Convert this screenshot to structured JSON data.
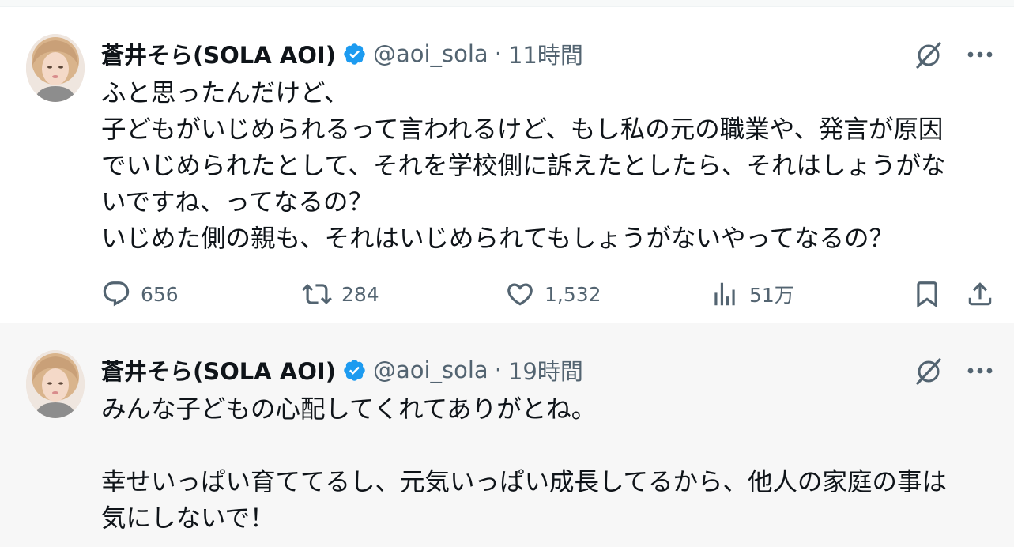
{
  "tweets": [
    {
      "author_name": "蒼井そら(SOLA AOI)",
      "handle": "@aoi_sola",
      "separator": "·",
      "time": "11時間",
      "lines": [
        "ふと思ったんだけど、",
        "子どもがいじめられるって言われるけど、もし私の元の職業や、発言が原因",
        "でいじめられたとして、それを学校側に訴えたとしたら、それはしょうがな",
        "いですね、ってなるの？",
        "いじめた側の親も、それはいじめられてもしょうがないやってなるの？"
      ],
      "stats": {
        "replies": "656",
        "retweets": "284",
        "likes": "1,532",
        "views": "51万"
      }
    },
    {
      "author_name": "蒼井そら(SOLA AOI)",
      "handle": "@aoi_sola",
      "separator": "·",
      "time": "19時間",
      "lines": [
        "みんな子どもの心配してくれてありがとね。",
        "",
        "幸せいっぱい育ててるし、元気いっぱい成長してるから、他人の家庭の事は",
        "気にしないで！"
      ]
    }
  ],
  "icons": {
    "verified": "verified-badge-icon",
    "grok": "grok-icon",
    "more": "more-icon",
    "reply": "reply-icon",
    "retweet": "retweet-icon",
    "like": "heart-icon",
    "views": "views-icon",
    "bookmark": "bookmark-icon",
    "share": "share-icon"
  },
  "colors": {
    "text": "#0f1419",
    "secondary": "#536471",
    "verified_blue": "#1d9bf0"
  }
}
